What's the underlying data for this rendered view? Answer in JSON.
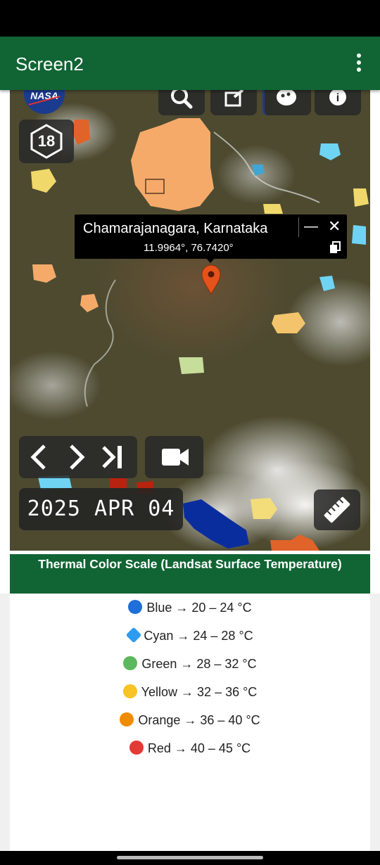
{
  "app_bar": {
    "title": "Screen2",
    "menu_icon": "more-vert-icon"
  },
  "map": {
    "logo_text": "NASA",
    "zoom_level": "18",
    "toolbar_icons": [
      "search-icon",
      "share-icon",
      "palette-icon",
      "info-icon"
    ],
    "popup": {
      "place": "Chamarajanagara, Karnataka",
      "coords": "11.9964°, 76.7420°"
    },
    "date": "2025 APR 04",
    "controls": [
      "previous-icon",
      "next-icon",
      "skip-to-end-icon",
      "video-icon",
      "ruler-icon"
    ],
    "colors": {
      "blue": "#0a2d9e",
      "cyan": "#5fd0f2",
      "green": "#c7dd9a",
      "yellow": "#f3dd7a",
      "orange": "#f5aa6a",
      "red": "#d94a1f"
    }
  },
  "scale": {
    "title": "Thermal Color Scale (Landsat Surface Temperature)",
    "items": [
      {
        "label": "Blue → 20 – 24 °C",
        "color": "#1e6fd9"
      },
      {
        "label": "Cyan → 24 – 28 °C",
        "color": "#2d9cf0"
      },
      {
        "label": "Green → 28 – 32 °C",
        "color": "#5cb85c"
      },
      {
        "label": "Yellow → 32 – 36 °C",
        "color": "#f7c325"
      },
      {
        "label": "Orange → 36 – 40 °C",
        "color": "#f08c00"
      },
      {
        "label": "Red → 40 – 45 °C",
        "color": "#e53935"
      }
    ]
  }
}
